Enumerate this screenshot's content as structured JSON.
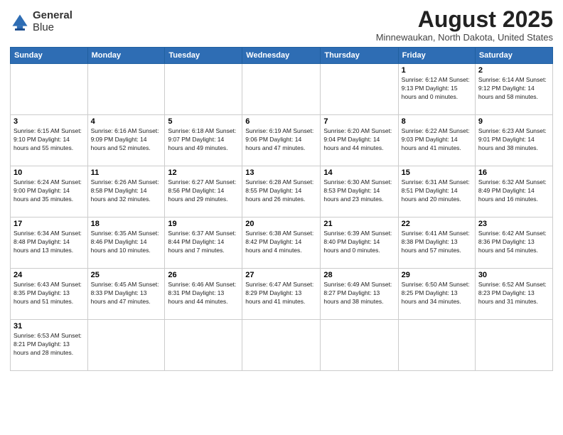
{
  "header": {
    "logo_line1": "General",
    "logo_line2": "Blue",
    "month": "August 2025",
    "location": "Minnewaukan, North Dakota, United States"
  },
  "weekdays": [
    "Sunday",
    "Monday",
    "Tuesday",
    "Wednesday",
    "Thursday",
    "Friday",
    "Saturday"
  ],
  "weeks": [
    [
      {
        "day": "",
        "info": ""
      },
      {
        "day": "",
        "info": ""
      },
      {
        "day": "",
        "info": ""
      },
      {
        "day": "",
        "info": ""
      },
      {
        "day": "",
        "info": ""
      },
      {
        "day": "1",
        "info": "Sunrise: 6:12 AM\nSunset: 9:13 PM\nDaylight: 15 hours\nand 0 minutes."
      },
      {
        "day": "2",
        "info": "Sunrise: 6:14 AM\nSunset: 9:12 PM\nDaylight: 14 hours\nand 58 minutes."
      }
    ],
    [
      {
        "day": "3",
        "info": "Sunrise: 6:15 AM\nSunset: 9:10 PM\nDaylight: 14 hours\nand 55 minutes."
      },
      {
        "day": "4",
        "info": "Sunrise: 6:16 AM\nSunset: 9:09 PM\nDaylight: 14 hours\nand 52 minutes."
      },
      {
        "day": "5",
        "info": "Sunrise: 6:18 AM\nSunset: 9:07 PM\nDaylight: 14 hours\nand 49 minutes."
      },
      {
        "day": "6",
        "info": "Sunrise: 6:19 AM\nSunset: 9:06 PM\nDaylight: 14 hours\nand 47 minutes."
      },
      {
        "day": "7",
        "info": "Sunrise: 6:20 AM\nSunset: 9:04 PM\nDaylight: 14 hours\nand 44 minutes."
      },
      {
        "day": "8",
        "info": "Sunrise: 6:22 AM\nSunset: 9:03 PM\nDaylight: 14 hours\nand 41 minutes."
      },
      {
        "day": "9",
        "info": "Sunrise: 6:23 AM\nSunset: 9:01 PM\nDaylight: 14 hours\nand 38 minutes."
      }
    ],
    [
      {
        "day": "10",
        "info": "Sunrise: 6:24 AM\nSunset: 9:00 PM\nDaylight: 14 hours\nand 35 minutes."
      },
      {
        "day": "11",
        "info": "Sunrise: 6:26 AM\nSunset: 8:58 PM\nDaylight: 14 hours\nand 32 minutes."
      },
      {
        "day": "12",
        "info": "Sunrise: 6:27 AM\nSunset: 8:56 PM\nDaylight: 14 hours\nand 29 minutes."
      },
      {
        "day": "13",
        "info": "Sunrise: 6:28 AM\nSunset: 8:55 PM\nDaylight: 14 hours\nand 26 minutes."
      },
      {
        "day": "14",
        "info": "Sunrise: 6:30 AM\nSunset: 8:53 PM\nDaylight: 14 hours\nand 23 minutes."
      },
      {
        "day": "15",
        "info": "Sunrise: 6:31 AM\nSunset: 8:51 PM\nDaylight: 14 hours\nand 20 minutes."
      },
      {
        "day": "16",
        "info": "Sunrise: 6:32 AM\nSunset: 8:49 PM\nDaylight: 14 hours\nand 16 minutes."
      }
    ],
    [
      {
        "day": "17",
        "info": "Sunrise: 6:34 AM\nSunset: 8:48 PM\nDaylight: 14 hours\nand 13 minutes."
      },
      {
        "day": "18",
        "info": "Sunrise: 6:35 AM\nSunset: 8:46 PM\nDaylight: 14 hours\nand 10 minutes."
      },
      {
        "day": "19",
        "info": "Sunrise: 6:37 AM\nSunset: 8:44 PM\nDaylight: 14 hours\nand 7 minutes."
      },
      {
        "day": "20",
        "info": "Sunrise: 6:38 AM\nSunset: 8:42 PM\nDaylight: 14 hours\nand 4 minutes."
      },
      {
        "day": "21",
        "info": "Sunrise: 6:39 AM\nSunset: 8:40 PM\nDaylight: 14 hours\nand 0 minutes."
      },
      {
        "day": "22",
        "info": "Sunrise: 6:41 AM\nSunset: 8:38 PM\nDaylight: 13 hours\nand 57 minutes."
      },
      {
        "day": "23",
        "info": "Sunrise: 6:42 AM\nSunset: 8:36 PM\nDaylight: 13 hours\nand 54 minutes."
      }
    ],
    [
      {
        "day": "24",
        "info": "Sunrise: 6:43 AM\nSunset: 8:35 PM\nDaylight: 13 hours\nand 51 minutes."
      },
      {
        "day": "25",
        "info": "Sunrise: 6:45 AM\nSunset: 8:33 PM\nDaylight: 13 hours\nand 47 minutes."
      },
      {
        "day": "26",
        "info": "Sunrise: 6:46 AM\nSunset: 8:31 PM\nDaylight: 13 hours\nand 44 minutes."
      },
      {
        "day": "27",
        "info": "Sunrise: 6:47 AM\nSunset: 8:29 PM\nDaylight: 13 hours\nand 41 minutes."
      },
      {
        "day": "28",
        "info": "Sunrise: 6:49 AM\nSunset: 8:27 PM\nDaylight: 13 hours\nand 38 minutes."
      },
      {
        "day": "29",
        "info": "Sunrise: 6:50 AM\nSunset: 8:25 PM\nDaylight: 13 hours\nand 34 minutes."
      },
      {
        "day": "30",
        "info": "Sunrise: 6:52 AM\nSunset: 8:23 PM\nDaylight: 13 hours\nand 31 minutes."
      }
    ],
    [
      {
        "day": "31",
        "info": "Sunrise: 6:53 AM\nSunset: 8:21 PM\nDaylight: 13 hours\nand 28 minutes."
      },
      {
        "day": "",
        "info": ""
      },
      {
        "day": "",
        "info": ""
      },
      {
        "day": "",
        "info": ""
      },
      {
        "day": "",
        "info": ""
      },
      {
        "day": "",
        "info": ""
      },
      {
        "day": "",
        "info": ""
      }
    ]
  ]
}
